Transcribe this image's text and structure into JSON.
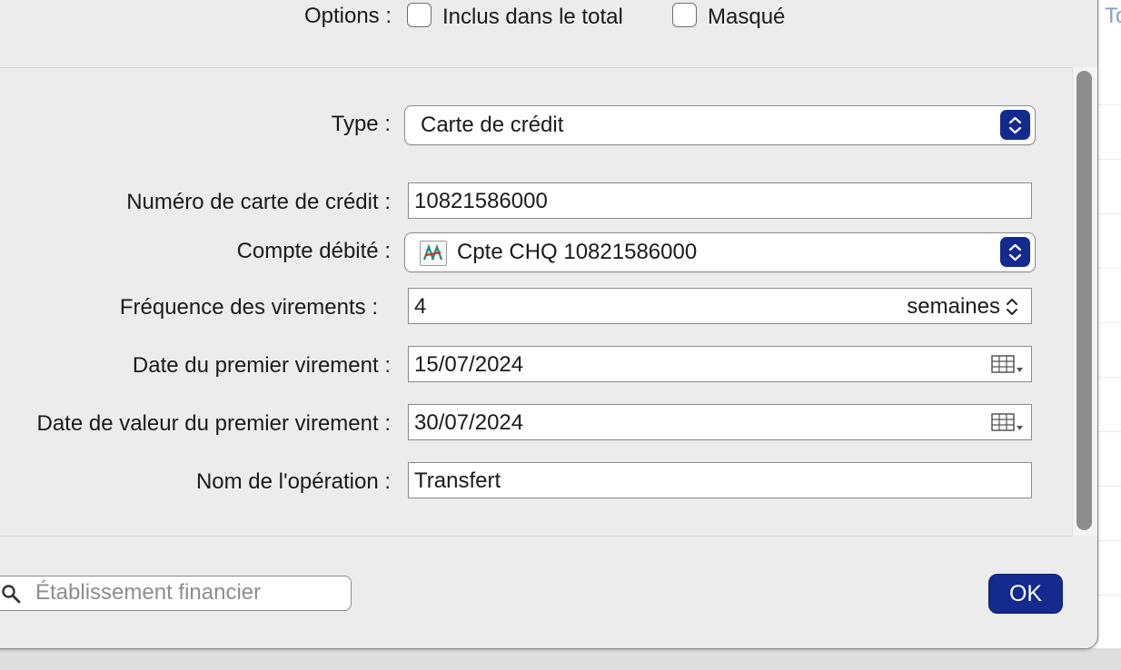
{
  "options": {
    "label": "Options :",
    "checkbox_total_label": "Inclus dans le total",
    "checkbox_total_checked": false,
    "checkbox_hidden_label": "Masqué",
    "checkbox_hidden_checked": false
  },
  "type": {
    "label": "Type :",
    "value": "Carte de crédit"
  },
  "card_number": {
    "label": "Numéro de carte de crédit :",
    "value": "10821586000"
  },
  "debited_account": {
    "label": "Compte débité :",
    "value": "Cpte CHQ 10821586000",
    "icon": "bank-logo-icon"
  },
  "frequency": {
    "label": "Fréquence des virements :",
    "value": "4",
    "unit": "semaines"
  },
  "first_transfer_date": {
    "label": "Date du premier virement :",
    "value": "15/07/2024"
  },
  "first_value_date": {
    "label": "Date de valeur du premier virement :",
    "value": "30/07/2024"
  },
  "operation_name": {
    "label": "Nom de l'opération :",
    "value": "Transfert"
  },
  "search": {
    "placeholder": "Établissement financier"
  },
  "ok_button": {
    "label": "OK"
  },
  "background": {
    "partial_text": "To"
  },
  "colors": {
    "accent": "#142a8e",
    "sheet": "#ececec"
  }
}
